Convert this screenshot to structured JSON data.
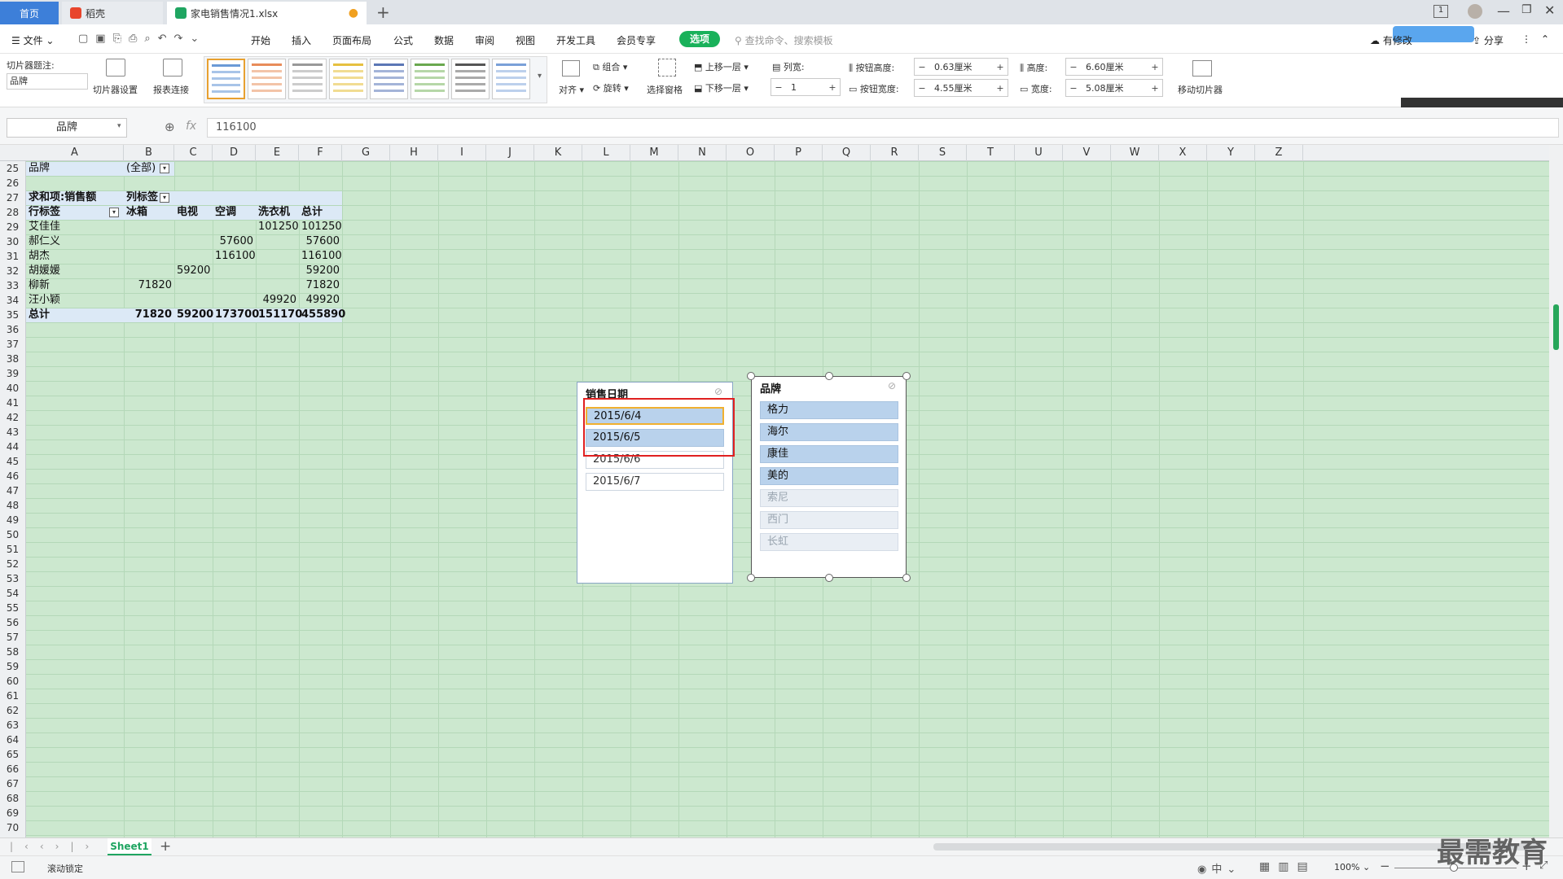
{
  "tabs": {
    "home": "首页",
    "dao": "稻壳",
    "file": "家电销售情况1.xlsx"
  },
  "menu": {
    "file": "文件",
    "items": [
      "开始",
      "插入",
      "页面布局",
      "公式",
      "数据",
      "审阅",
      "视图",
      "开发工具",
      "会员专享"
    ],
    "active_tab": "选项",
    "search": "查找命令、搜索模板",
    "share": "分享",
    "cloud": "有修改"
  },
  "ribbon": {
    "caption_label": "切片器题注:",
    "caption_value": "品牌",
    "settings": "切片器设置",
    "report_conn": "报表连接",
    "align": "对齐",
    "group": "组合",
    "rotate": "旋转",
    "select_pane": "选择窗格",
    "bring_up": "上移一层",
    "send_down": "下移一层",
    "columns_label": "列宽:",
    "columns_value": "1",
    "btn_height_label": "按钮高度:",
    "btn_height": "0.63厘米",
    "btn_width_label": "按钮宽度:",
    "btn_width": "4.55厘米",
    "height_label": "高度:",
    "height": "6.60厘米",
    "width_label": "宽度:",
    "width": "5.08厘米",
    "move_slicer": "移动切片器"
  },
  "formula": {
    "name_box": "品牌",
    "fx": "fx",
    "value": "116100"
  },
  "columns": [
    "A",
    "B",
    "C",
    "D",
    "E",
    "F",
    "G",
    "H",
    "I",
    "J",
    "K",
    "L",
    "M",
    "N",
    "O",
    "P",
    "Q",
    "R",
    "S",
    "T",
    "U",
    "V",
    "W",
    "X",
    "Y",
    "Z"
  ],
  "rows": [
    "25",
    "26",
    "27",
    "28",
    "29",
    "30",
    "31",
    "32",
    "33",
    "34",
    "35",
    "36",
    "37",
    "38",
    "39",
    "40",
    "41",
    "42",
    "43",
    "44",
    "45",
    "46",
    "47",
    "48",
    "49",
    "50",
    "51",
    "52",
    "53",
    "54",
    "55",
    "56",
    "57",
    "58",
    "59",
    "60",
    "61",
    "62",
    "63",
    "64",
    "65",
    "66",
    "67",
    "68",
    "69",
    "70"
  ],
  "pivot": {
    "filter_label": "品牌",
    "filter_value": "(全部)",
    "sum_label": "求和项:销售额",
    "col_label": "列标签",
    "row_label": "行标签",
    "headers": [
      "冰箱",
      "电视",
      "空调",
      "洗衣机",
      "总计"
    ],
    "rows": [
      {
        "name": "艾佳佳",
        "vals": [
          "",
          "",
          "",
          "101250",
          "101250"
        ]
      },
      {
        "name": "郝仁义",
        "vals": [
          "",
          "",
          "57600",
          "",
          "57600"
        ]
      },
      {
        "name": "胡杰",
        "vals": [
          "",
          "",
          "116100",
          "",
          "116100"
        ]
      },
      {
        "name": "胡媛媛",
        "vals": [
          "",
          "59200",
          "",
          "",
          "59200"
        ]
      },
      {
        "name": "柳新",
        "vals": [
          "71820",
          "",
          "",
          "",
          "71820"
        ]
      },
      {
        "name": "汪小颖",
        "vals": [
          "",
          "",
          "",
          "49920",
          "49920"
        ]
      }
    ],
    "total": {
      "name": "总计",
      "vals": [
        "71820",
        "59200",
        "173700",
        "151170",
        "455890"
      ]
    }
  },
  "slicer_date": {
    "title": "销售日期",
    "items": [
      "2015/6/4",
      "2015/6/5",
      "2015/6/6",
      "2015/6/7"
    ]
  },
  "slicer_brand": {
    "title": "品牌",
    "items": [
      "格力",
      "海尔",
      "康佳",
      "美的",
      "索尼",
      "西门",
      "长虹"
    ]
  },
  "sheet_tab": "Sheet1",
  "status": {
    "scroll_lock": "滚动锁定",
    "zoom": "100%"
  },
  "watermark": "最需教育",
  "colors": {
    "accent": "#3d7fd9",
    "sheet_bg": "#cce8cf",
    "highlight_red": "#e02020",
    "option_green": "#19b15a"
  }
}
